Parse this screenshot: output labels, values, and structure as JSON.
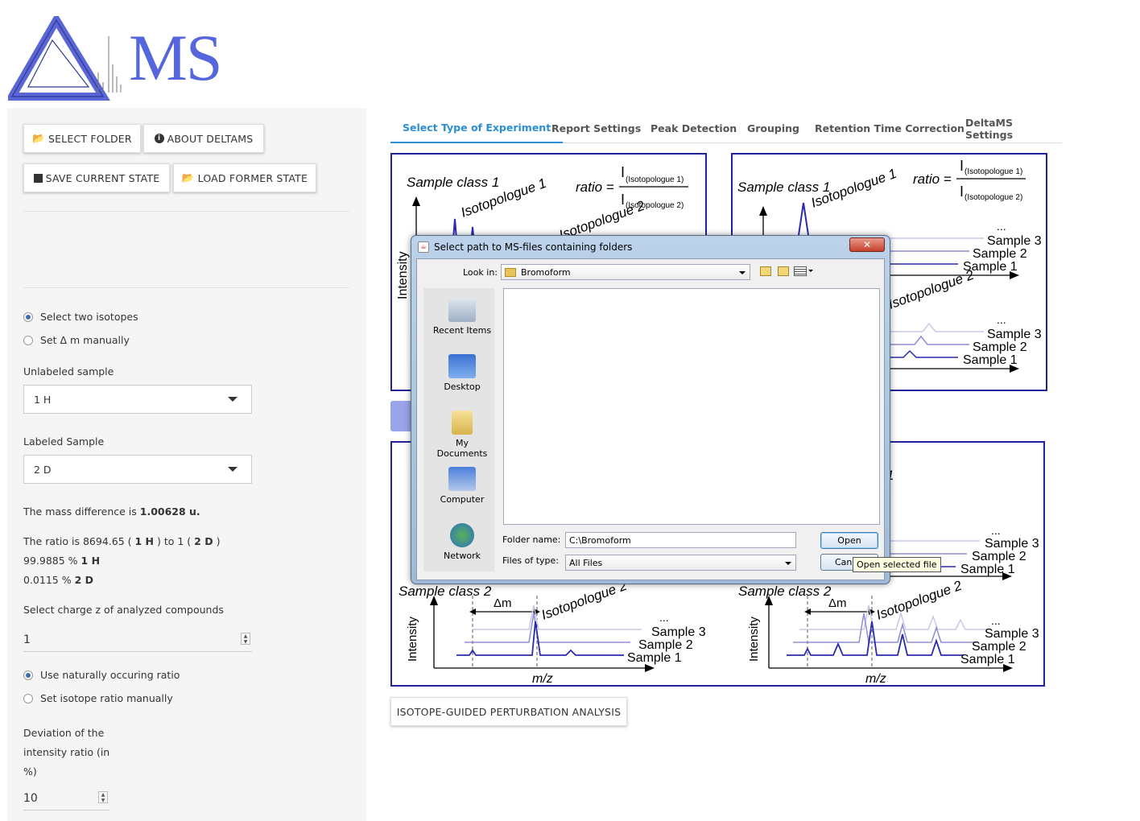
{
  "logo": {
    "text": "MS"
  },
  "sidebar": {
    "buttons": {
      "select_folder": "SELECT FOLDER",
      "about": "ABOUT DELTAMS",
      "save_state": "SAVE CURRENT STATE",
      "load_state": "LOAD FORMER STATE"
    },
    "isotope_mode": {
      "options": [
        "Select two isotopes",
        "Set Δ m manually"
      ],
      "selected": 0
    },
    "unlabeled": {
      "label": "Unlabeled sample",
      "value": "1 H"
    },
    "labeled": {
      "label": "Labeled Sample",
      "value": "2 D"
    },
    "mass_diff": {
      "prefix": "The mass difference is",
      "value": "1.00628 u."
    },
    "ratio": {
      "text_a": "The ratio is 8694.65 (",
      "iso1": "1 H",
      "text_b": ") to 1 (",
      "iso2": "2 D",
      "text_c": ")",
      "pct1": "99.9885 %",
      "pct1_iso": "1 H",
      "pct2": "0.0115 %",
      "pct2_iso": "2 D"
    },
    "charge": {
      "label": "Select charge z of analyzed compounds",
      "value": "1"
    },
    "ratio_mode": {
      "options": [
        "Use naturally occuring ratio",
        "Set isotope ratio manually"
      ],
      "selected": 0
    },
    "deviation": {
      "label_lines": [
        "Deviation of the",
        "intensity ratio (in",
        "%)"
      ],
      "value": "10"
    }
  },
  "tabs": [
    {
      "label": "Select Type of Experiment",
      "active": true
    },
    {
      "label": "Report Settings",
      "active": false
    },
    {
      "label": "Peak Detection",
      "active": false
    },
    {
      "label": "Grouping",
      "active": false
    },
    {
      "label": "Retention Time Correction",
      "active": false
    },
    {
      "label": "DeltaMS Settings",
      "active": false
    }
  ],
  "figures": {
    "sample_class_1": "Sample class 1",
    "sample_class_2": "Sample class 2",
    "isotopologue_1": "Isotopologue 1",
    "isotopologue_2": "Isotopologue 2",
    "ratio_label": "ratio =",
    "numerator": "(Isotopologue 1)",
    "denominator": "(Isotopologue 2)",
    "intensity": "Intensity",
    "mz": "m/z",
    "delta_m": "Δm",
    "ellipsis": "...",
    "samples": [
      "Sample 3",
      "Sample 2",
      "Sample 1"
    ]
  },
  "perturbation_button": "ISOTOPE-GUIDED PERTURBATION ANALYSIS",
  "dialog": {
    "title": "Select path to MS-files containing folders",
    "look_in_label": "Look in:",
    "look_in_value": "Bromoform",
    "places": [
      "Recent Items",
      "Desktop",
      "My Documents",
      "Computer",
      "Network"
    ],
    "folder_name_label": "Folder name:",
    "folder_name_value": "C:\\Bromoform",
    "files_of_type_label": "Files of type:",
    "files_of_type_value": "All Files",
    "open_button": "Open",
    "cancel_button": "Cancel",
    "tooltip": "Open selected file"
  }
}
